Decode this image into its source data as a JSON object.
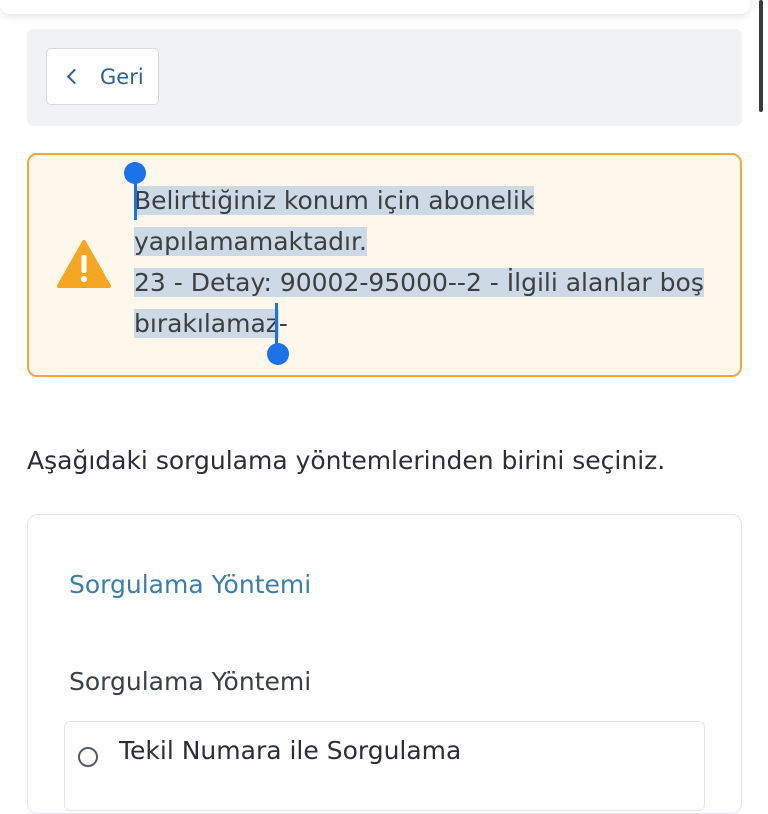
{
  "back": {
    "label": "Geri"
  },
  "alert": {
    "lines": [
      "Belirttiğiniz konum için abonelik",
      "yapılamamaktadır.",
      "23 - Detay: 90002-95000--2 - İlgili alanlar boş",
      "bırakılamaz"
    ],
    "trailing": "-",
    "icon": "warning-icon",
    "border_color": "#f2a93b",
    "background_color": "#fef8ec",
    "icon_color": "#f5a623"
  },
  "instruction": "Aşağıdaki sorgulama yöntemlerinden birini seçiniz.",
  "method_card": {
    "title": "Sorgulama Yöntemi",
    "field_label": "Sorgulama Yöntemi",
    "options": [
      {
        "label": "Tekil Numara ile Sorgulama",
        "selected": false
      }
    ]
  },
  "colors": {
    "accent": "#2e5f95",
    "title_blue": "#3a7fab",
    "selection": "#cdd9e4",
    "selection_handle": "#1a73e8"
  }
}
